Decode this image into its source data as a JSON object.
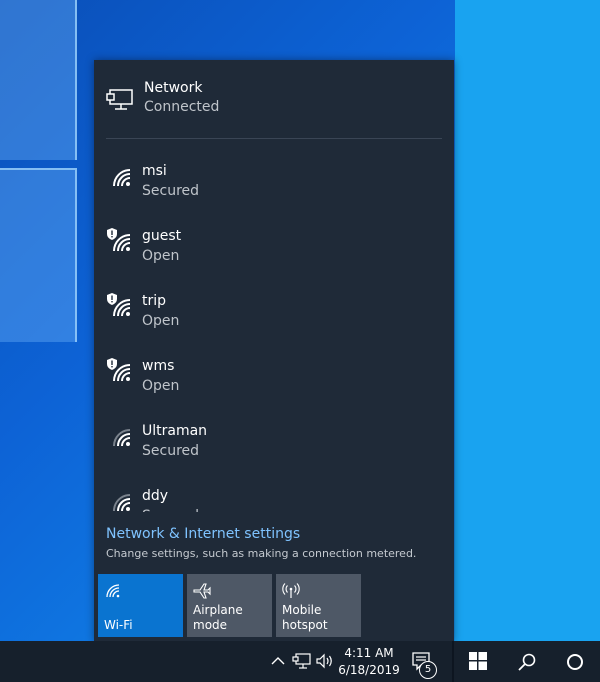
{
  "wired": {
    "name": "Network",
    "status": "Connected"
  },
  "networks": [
    {
      "name": "msi",
      "state": "Secured",
      "warning": false
    },
    {
      "name": "guest",
      "state": "Open",
      "warning": true
    },
    {
      "name": "trip",
      "state": "Open",
      "warning": true
    },
    {
      "name": "wms",
      "state": "Open",
      "warning": true
    },
    {
      "name": "Ultraman",
      "state": "Secured",
      "warning": false
    },
    {
      "name": "ddy",
      "state": "Secured",
      "warning": false
    }
  ],
  "settings": {
    "link": "Network & Internet settings",
    "description": "Change settings, such as making a connection metered."
  },
  "quick_actions": [
    {
      "label": "Wi-Fi",
      "icon": "wifi-icon",
      "active": true
    },
    {
      "label": "Airplane mode",
      "icon": "airplane-icon",
      "active": false
    },
    {
      "label": "Mobile hotspot",
      "icon": "hotspot-icon",
      "active": false
    }
  ],
  "taskbar": {
    "time": "4:11 AM",
    "date": "6/18/2019",
    "notification_count": "5"
  },
  "colors": {
    "flyout_bg": "#1f2a38",
    "accent": "#0a74d0",
    "link": "#7fc3ff"
  }
}
